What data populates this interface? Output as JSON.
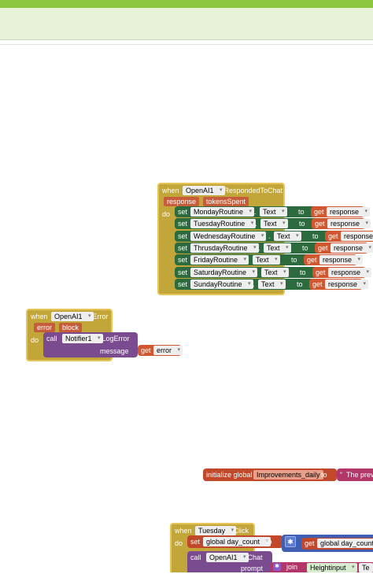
{
  "respondedToChat": {
    "when": "when",
    "component": "OpenAI1",
    "event": ".RespondedToChat",
    "params": [
      "response",
      "tokensSpent"
    ],
    "do": "do",
    "rows": [
      {
        "set": "set",
        "component": "MondayRoutine",
        "prop": "Text",
        "to": "to",
        "get": "get",
        "var": "response"
      },
      {
        "set": "set",
        "component": "TuesdayRoutine",
        "prop": "Text",
        "to": "to",
        "get": "get",
        "var": "response"
      },
      {
        "set": "set",
        "component": "WednesdayRoutine",
        "prop": "Text",
        "to": "to",
        "get": "get",
        "var": "response"
      },
      {
        "set": "set",
        "component": "ThrusdayRoutine",
        "prop": "Text",
        "to": "to",
        "get": "get",
        "var": "response"
      },
      {
        "set": "set",
        "component": "FridayRoutine",
        "prop": "Text",
        "to": "to",
        "get": "get",
        "var": "response"
      },
      {
        "set": "set",
        "component": "SaturdayRoutine",
        "prop": "Text",
        "to": "to",
        "get": "get",
        "var": "response"
      },
      {
        "set": "set",
        "component": "SundayRoutine",
        "prop": "Text",
        "to": "to",
        "get": "get",
        "var": "response"
      }
    ]
  },
  "errorBlock": {
    "when": "when",
    "component": "OpenAI1",
    "event": ".Error",
    "params": [
      "error",
      "block"
    ],
    "do": "do",
    "call": "call",
    "notifier": "Notifier1",
    "method": ".LogError",
    "message": "message",
    "get": "get",
    "var": "error"
  },
  "globalInit": {
    "label": "initialize global",
    "name": "Improvements_daily",
    "to": "to",
    "text": "The prev"
  },
  "tuesdayClick": {
    "when": "when",
    "component": "Tuesday",
    "event": ".Click",
    "do": "do",
    "set": "set",
    "setVar": "global day_count",
    "to": "to",
    "get": "get",
    "getVar": "global day_count",
    "call": "call",
    "callComponent": "OpenAI1",
    "callMethod": ".Chat",
    "prompt": "prompt",
    "join": "join",
    "joinItem": "Heightinput",
    "cut": "Te"
  },
  "colors": {
    "component_event": "#c3a63a",
    "setter": "#2b6b3d",
    "getter": "#d0572f",
    "variable": "#c1482a",
    "procedure_call": "#7a4c8f",
    "text": "#b3366a",
    "math": "#3f5fb5"
  }
}
